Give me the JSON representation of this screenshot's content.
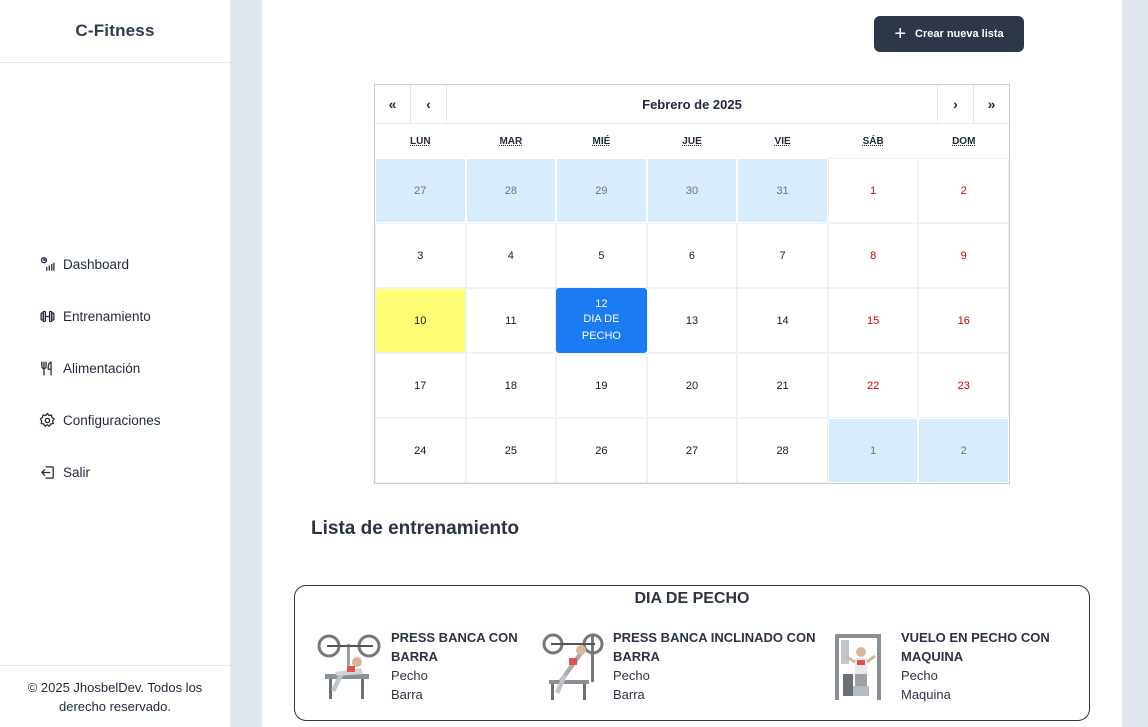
{
  "app": {
    "brand": "C-Fitness"
  },
  "sidebar": {
    "items": [
      {
        "label": "Dashboard",
        "icon": "dashboard-icon"
      },
      {
        "label": "Entrenamiento",
        "icon": "dumbbell-icon"
      },
      {
        "label": "Alimentación",
        "icon": "utensils-icon"
      },
      {
        "label": "Configuraciones",
        "icon": "gear-icon"
      },
      {
        "label": "Salir",
        "icon": "logout-icon"
      }
    ],
    "footer": "© 2025 JhosbelDev. Todos los derecho reservado."
  },
  "toolbar": {
    "create_label": "Crear nueva lista",
    "create_icon": "+"
  },
  "calendar": {
    "month_label": "Febrero de 2025",
    "nav": {
      "prev_year": "«",
      "prev_month": "‹",
      "next_month": "›",
      "next_year": "»"
    },
    "weekdays": [
      "LUN",
      "MAR",
      "MIÉ",
      "JUE",
      "VIE",
      "SÁB",
      "DOM"
    ],
    "days": [
      {
        "d": "27",
        "other": true
      },
      {
        "d": "28",
        "other": true
      },
      {
        "d": "29",
        "other": true
      },
      {
        "d": "30",
        "other": true
      },
      {
        "d": "31",
        "other": true
      },
      {
        "d": "1",
        "weekend": true
      },
      {
        "d": "2",
        "weekend": true
      },
      {
        "d": "3"
      },
      {
        "d": "4"
      },
      {
        "d": "5"
      },
      {
        "d": "6"
      },
      {
        "d": "7"
      },
      {
        "d": "8",
        "weekend": true
      },
      {
        "d": "9",
        "weekend": true
      },
      {
        "d": "10",
        "today": true
      },
      {
        "d": "11"
      },
      {
        "d": "12",
        "event": [
          "DIA DE",
          "PECHO"
        ]
      },
      {
        "d": "13"
      },
      {
        "d": "14"
      },
      {
        "d": "15",
        "weekend": true
      },
      {
        "d": "16",
        "weekend": true
      },
      {
        "d": "17"
      },
      {
        "d": "18"
      },
      {
        "d": "19"
      },
      {
        "d": "20"
      },
      {
        "d": "21"
      },
      {
        "d": "22",
        "weekend": true
      },
      {
        "d": "23",
        "weekend": true
      },
      {
        "d": "24"
      },
      {
        "d": "25"
      },
      {
        "d": "26"
      },
      {
        "d": "27"
      },
      {
        "d": "28"
      },
      {
        "d": "1",
        "other": true
      },
      {
        "d": "2",
        "other": true
      }
    ],
    "colors": {
      "other_month": "#d8ecfb",
      "today": "#ffff76",
      "event": "#1a7cf0",
      "weekend_text": "#d10000"
    }
  },
  "training": {
    "heading": "Lista de entrenamiento",
    "list_title": "DIA DE PECHO",
    "exercises": [
      {
        "name_line1": "PRESS BANCA CON",
        "name_line2": "BARRA",
        "muscle": "Pecho",
        "equipment": "Barra"
      },
      {
        "name_line1": "PRESS BANCA INCLINADO CON",
        "name_line2": "BARRA",
        "muscle": "Pecho",
        "equipment": "Barra"
      },
      {
        "name_line1": "VUELO EN PECHO CON",
        "name_line2": "MAQUINA",
        "muscle": "Pecho",
        "equipment": "Maquina"
      }
    ]
  }
}
